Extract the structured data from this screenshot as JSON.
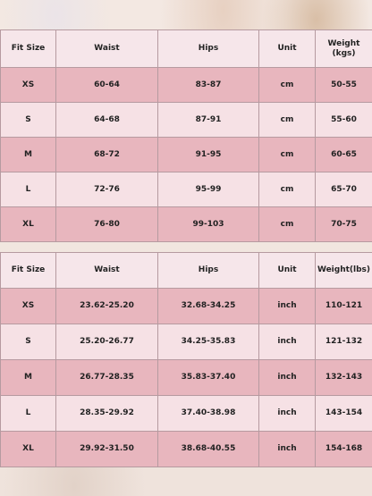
{
  "metric_table": {
    "headers": [
      "Fit Size",
      "Waist",
      "Hips",
      "Unit",
      "Weight\n(kgs)"
    ],
    "rows": [
      [
        "XS",
        "60-64",
        "83-87",
        "cm",
        "50-55"
      ],
      [
        "S",
        "64-68",
        "87-91",
        "cm",
        "55-60"
      ],
      [
        "M",
        "68-72",
        "91-95",
        "cm",
        "60-65"
      ],
      [
        "L",
        "72-76",
        "95-99",
        "cm",
        "65-70"
      ],
      [
        "XL",
        "76-80",
        "99-103",
        "cm",
        "70-75"
      ]
    ]
  },
  "imperial_table": {
    "headers": [
      "Fit Size",
      "Waist",
      "Hips",
      "Unit",
      "Weight(lbs)"
    ],
    "rows": [
      [
        "XS",
        "23.62-25.20",
        "32.68-34.25",
        "inch",
        "110-121"
      ],
      [
        "S",
        "25.20-26.77",
        "34.25-35.83",
        "inch",
        "121-132"
      ],
      [
        "M",
        "26.77-28.35",
        "35.83-37.40",
        "inch",
        "132-143"
      ],
      [
        "L",
        "28.35-29.92",
        "37.40-38.98",
        "inch",
        "143-154"
      ],
      [
        "XL",
        "29.92-31.50",
        "38.68-40.55",
        "inch",
        "154-168"
      ]
    ]
  }
}
